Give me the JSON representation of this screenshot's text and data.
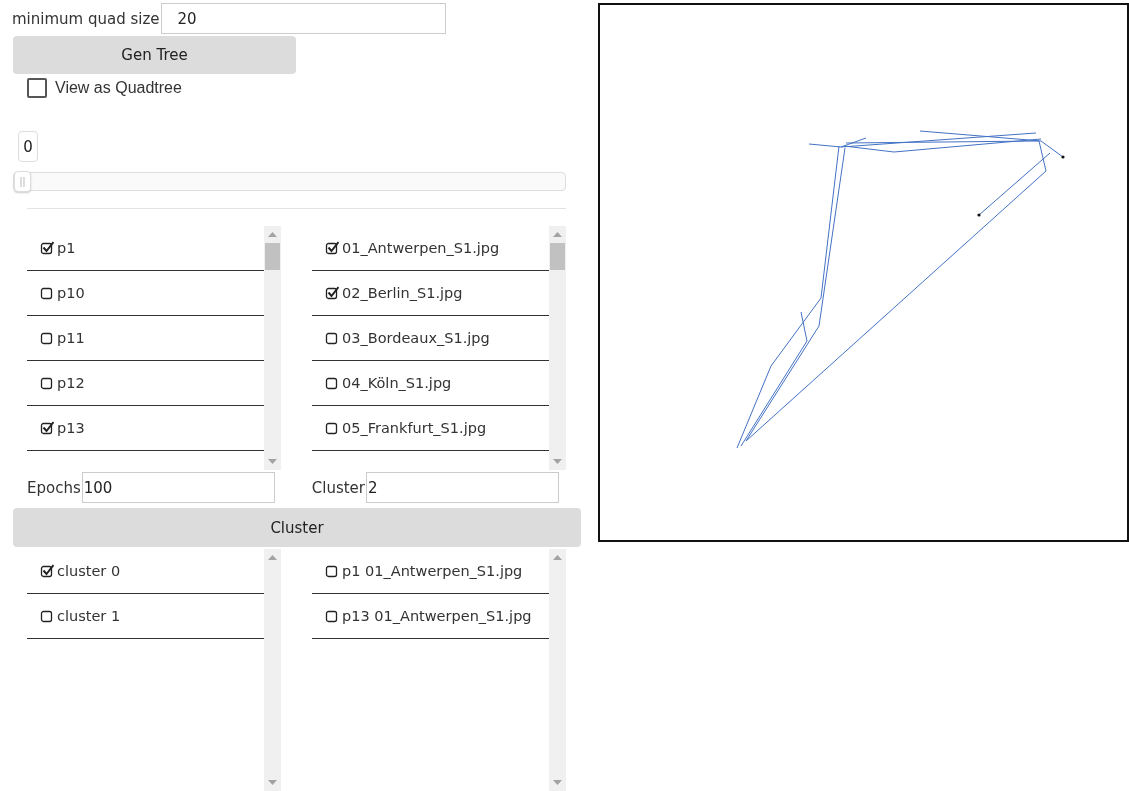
{
  "quad_size": {
    "label": "minimum quad size",
    "value": "20"
  },
  "gen_tree_button": {
    "label": "Gen Tree"
  },
  "view_as_quadtree": {
    "label": "View as Quadtree",
    "checked": false
  },
  "frame_slider": {
    "reading": "0",
    "level": 0
  },
  "persons_list": {
    "items": [
      {
        "label": "p1",
        "checked": true
      },
      {
        "label": "p10",
        "checked": false
      },
      {
        "label": "p11",
        "checked": false
      },
      {
        "label": "p12",
        "checked": false
      },
      {
        "label": "p13",
        "checked": true
      }
    ]
  },
  "images_list": {
    "items": [
      {
        "label": "01_Antwerpen_S1.jpg",
        "checked": true
      },
      {
        "label": "02_Berlin_S1.jpg",
        "checked": true
      },
      {
        "label": "03_Bordeaux_S1.jpg",
        "checked": false
      },
      {
        "label": "04_Köln_S1.jpg",
        "checked": false
      },
      {
        "label": "05_Frankfurt_S1.jpg",
        "checked": false
      }
    ]
  },
  "epochs": {
    "label": "Epochs",
    "value": "100"
  },
  "cluster_count": {
    "label": "Cluster",
    "value": "2"
  },
  "cluster_button": {
    "label": "Cluster"
  },
  "clusters_list": {
    "items": [
      {
        "label": "cluster 0",
        "checked": true
      },
      {
        "label": "cluster 1",
        "checked": false
      }
    ]
  },
  "cluster_members_list": {
    "items": [
      {
        "label": "p1 01_Antwerpen_S1.jpg",
        "checked": false
      },
      {
        "label": "p13 01_Antwerpen_S1.jpg",
        "checked": false
      }
    ]
  }
}
